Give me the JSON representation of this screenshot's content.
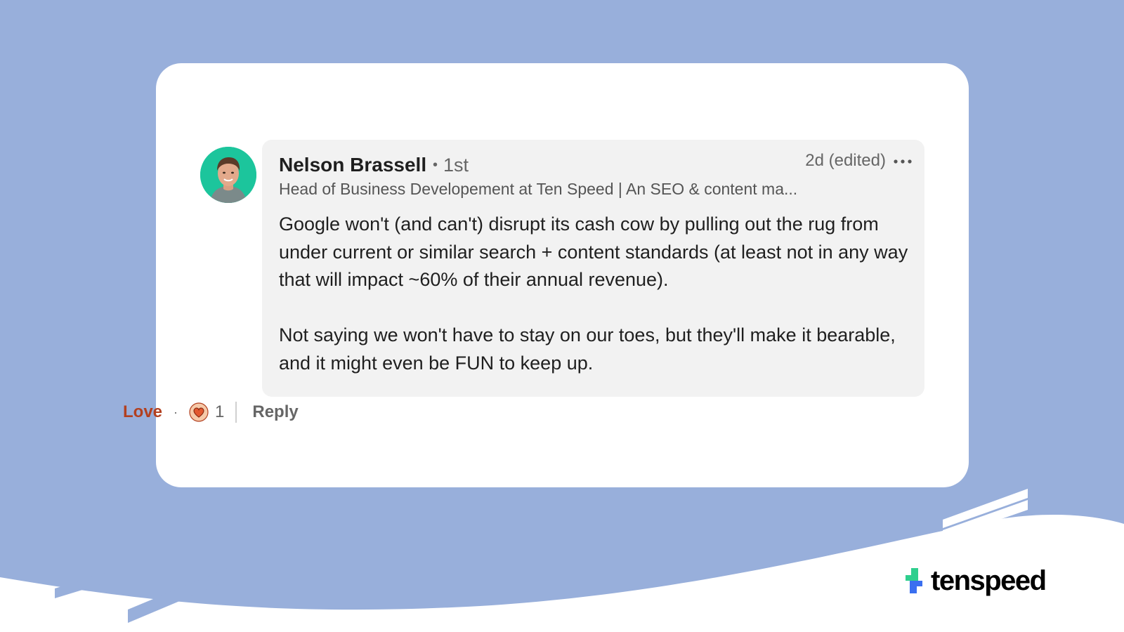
{
  "comment": {
    "author": {
      "name": "Nelson Brassell",
      "connection": "1st",
      "headline": "Head of Business Developement at Ten Speed | An SEO & content ma..."
    },
    "timestamp": "2d (edited)",
    "body_paragraphs": [
      "Google won't (and can't) disrupt its cash cow by pulling out the rug from under current or similar search + content standards (at least not in any way that will impact ~60% of their annual revenue).",
      "Not saying we won't have to stay on our toes, but they'll make it bearable, and it might even be FUN to keep up."
    ],
    "actions": {
      "reaction_label": "Love",
      "reaction_count": "1",
      "reply_label": "Reply"
    }
  },
  "brand": {
    "name": "tenspeed"
  },
  "colors": {
    "background": "#98afdb",
    "card": "#ffffff",
    "bubble": "#f2f2f2",
    "love": "#b24020",
    "avatar_bg": "#1cc59c",
    "brand_green": "#2ecf8e",
    "brand_blue": "#3a6ff0"
  },
  "icons": {
    "reaction": "heart-reaction-icon",
    "more": "ellipsis-icon",
    "brand": "tenspeed-logo-icon"
  }
}
